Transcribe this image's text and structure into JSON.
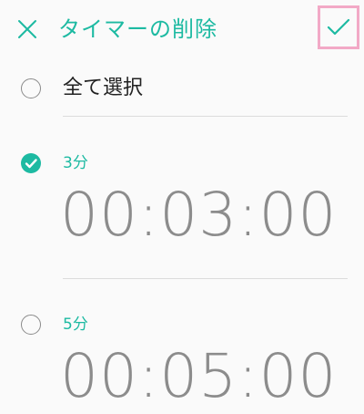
{
  "header": {
    "title": "タイマーの削除",
    "close_icon": "close-icon",
    "confirm_icon": "check-icon"
  },
  "select_all": {
    "label": "全て選択",
    "checked": false
  },
  "timers": [
    {
      "name": "3分",
      "time": "00:03:00",
      "checked": true
    },
    {
      "name": "5分",
      "time": "00:05:00",
      "checked": false
    }
  ],
  "colors": {
    "accent": "#1dbaa2",
    "highlight": "#f2a9c6",
    "time_text": "#8c8c8c"
  }
}
